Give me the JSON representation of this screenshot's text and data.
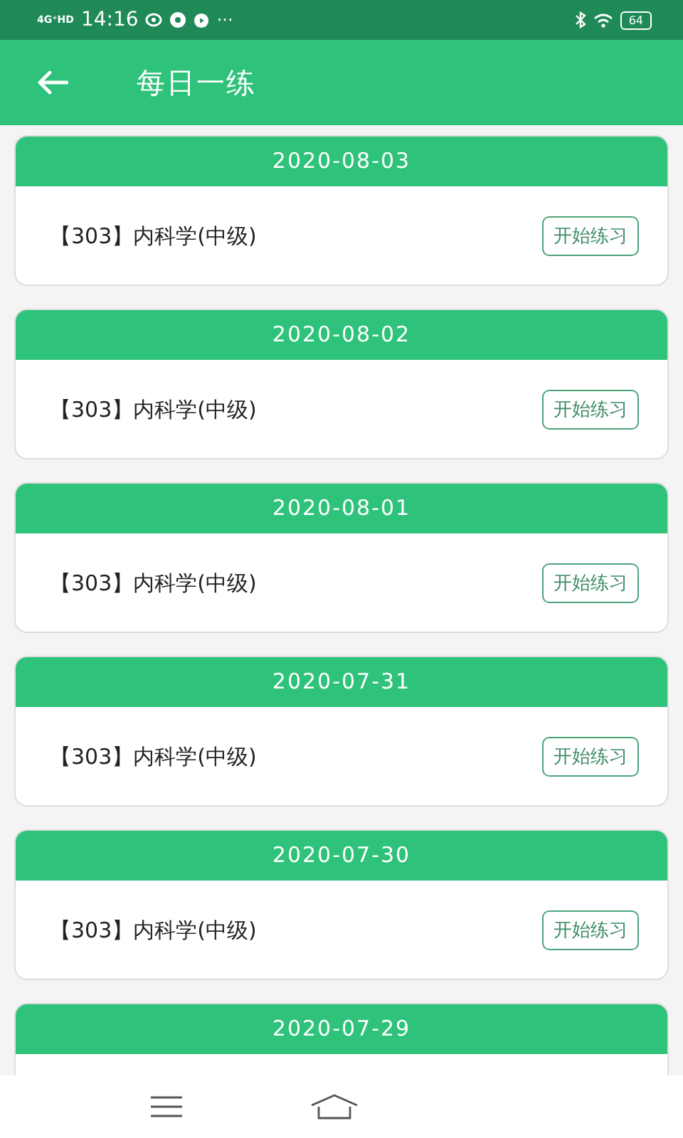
{
  "status_bar": {
    "network": "4G⁺HD",
    "time": "14:16",
    "more": "···",
    "battery": "64"
  },
  "header": {
    "title": "每日一练"
  },
  "cards": [
    {
      "date": "2020-08-03",
      "subject": "【303】内科学(中级)",
      "button": "开始练习"
    },
    {
      "date": "2020-08-02",
      "subject": "【303】内科学(中级)",
      "button": "开始练习"
    },
    {
      "date": "2020-08-01",
      "subject": "【303】内科学(中级)",
      "button": "开始练习"
    },
    {
      "date": "2020-07-31",
      "subject": "【303】内科学(中级)",
      "button": "开始练习"
    },
    {
      "date": "2020-07-30",
      "subject": "【303】内科学(中级)",
      "button": "开始练习"
    },
    {
      "date": "2020-07-29"
    }
  ]
}
